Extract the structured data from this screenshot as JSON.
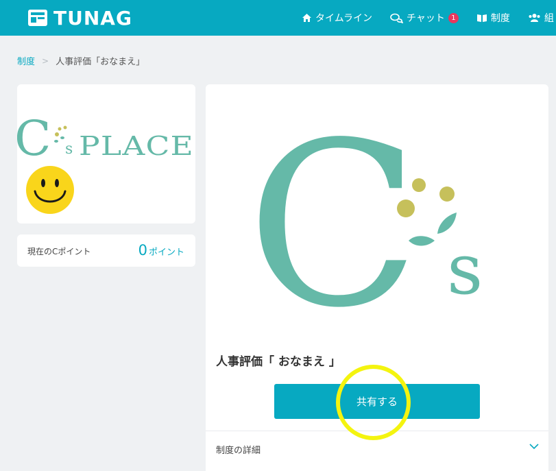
{
  "header": {
    "logo_text": "TUNAG",
    "nav": [
      {
        "icon": "home-icon",
        "label": "タイムライン"
      },
      {
        "icon": "chat-icon",
        "label": "チャット",
        "badge": "1"
      },
      {
        "icon": "book-icon",
        "label": "制度"
      },
      {
        "icon": "users-icon",
        "label": "組"
      }
    ]
  },
  "breadcrumb": {
    "root": "制度",
    "separator": ">",
    "current": "人事評価「おなまえ」"
  },
  "profile": {
    "logo_letter": "C",
    "logo_small": "s",
    "logo_text": "PLACE"
  },
  "points": {
    "label": "現在のCポイント",
    "value": "0",
    "unit": "ポイント"
  },
  "main": {
    "emblem_letter": "C",
    "emblem_small": "s",
    "title": "人事評価「 おなまえ 」",
    "share_label": "共有する",
    "details_label": "制度の詳細"
  },
  "colors": {
    "brand": "#07a9c1",
    "logo_teal": "#65b9a8",
    "dot_olive": "#c6c05b",
    "badge": "#e8365d",
    "highlight": "#f4f40f"
  }
}
